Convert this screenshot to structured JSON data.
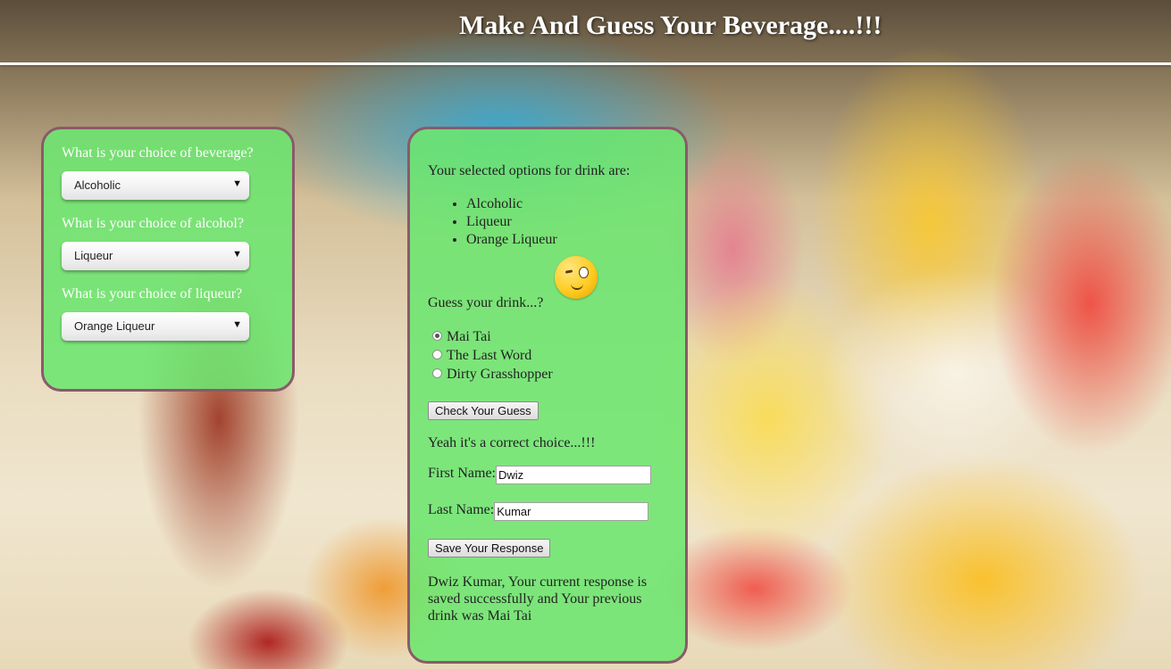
{
  "header": {
    "title": "Make And Guess Your Beverage....!!!"
  },
  "left_panel": {
    "beverage": {
      "question": "What is your choice of beverage?",
      "selected": "Alcoholic"
    },
    "alcohol": {
      "question": "What is your choice of alcohol?",
      "selected": "Liqueur"
    },
    "liqueur": {
      "question": "What is your choice of liqueur?",
      "selected": "Orange Liqueur"
    }
  },
  "center_panel": {
    "selected_heading": "Your selected options for drink are:",
    "selected_options": [
      "Alcoholic",
      "Liqueur",
      "Orange Liqueur"
    ],
    "guess_prompt": "Guess your drink...?",
    "guess_options": [
      {
        "label": "Mai Tai",
        "checked": true
      },
      {
        "label": "The Last Word",
        "checked": false
      },
      {
        "label": "Dirty Grasshopper",
        "checked": false
      }
    ],
    "check_button": "Check Your Guess",
    "result_text": "Yeah it's a correct choice...!!!",
    "first_name": {
      "label": "First Name:",
      "value": "Dwiz"
    },
    "last_name": {
      "label": "Last Name:",
      "value": "Kumar"
    },
    "save_button": "Save Your Response",
    "save_message": "Dwiz Kumar, Your current response is saved successfully and Your previous drink was Mai Tai"
  },
  "icons": {
    "emoji": "winking-thinking-emoji-icon",
    "dropdown": "triangle-down-icon"
  },
  "colors": {
    "panel_bg": "#6ce670",
    "panel_border": "#8a5a6a",
    "title": "#ffffff"
  }
}
